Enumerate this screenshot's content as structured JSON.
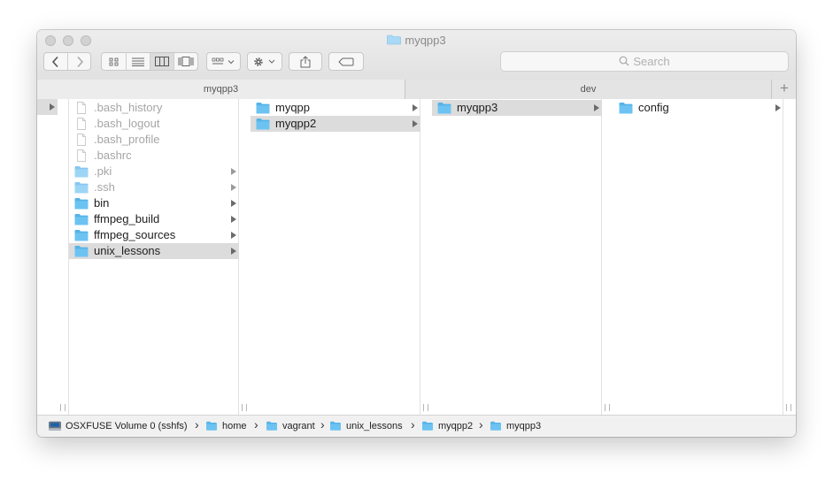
{
  "window": {
    "title": "myqpp3"
  },
  "toolbar": {
    "back_icon": "chevron-left-icon",
    "forward_icon": "chevron-right-icon",
    "view_modes": [
      "icon-view",
      "list-view",
      "column-view",
      "gallery-view"
    ],
    "active_view": "column-view",
    "search_placeholder": "Search"
  },
  "tabs": [
    {
      "label": "myqpp3",
      "active": true
    },
    {
      "label": "dev",
      "active": false
    }
  ],
  "columns": [
    {
      "items": []
    },
    {
      "items": [
        {
          "label": ".bash_history",
          "kind": "file",
          "dim": true,
          "arrow": false,
          "selected": false
        },
        {
          "label": ".bash_logout",
          "kind": "file",
          "dim": true,
          "arrow": false,
          "selected": false
        },
        {
          "label": ".bash_profile",
          "kind": "file",
          "dim": true,
          "arrow": false,
          "selected": false
        },
        {
          "label": ".bashrc",
          "kind": "file",
          "dim": true,
          "arrow": false,
          "selected": false
        },
        {
          "label": ".pki",
          "kind": "folder",
          "dim": true,
          "arrow": true,
          "selected": false
        },
        {
          "label": ".ssh",
          "kind": "folder",
          "dim": true,
          "arrow": true,
          "selected": false
        },
        {
          "label": "bin",
          "kind": "folder",
          "dim": false,
          "arrow": true,
          "selected": false
        },
        {
          "label": "ffmpeg_build",
          "kind": "folder",
          "dim": false,
          "arrow": true,
          "selected": false
        },
        {
          "label": "ffmpeg_sources",
          "kind": "folder",
          "dim": false,
          "arrow": true,
          "selected": false
        },
        {
          "label": "unix_lessons",
          "kind": "folder",
          "dim": false,
          "arrow": true,
          "selected": true
        }
      ]
    },
    {
      "items": [
        {
          "label": "myqpp",
          "kind": "folder",
          "dim": false,
          "arrow": true,
          "selected": false
        },
        {
          "label": "myqpp2",
          "kind": "folder",
          "dim": false,
          "arrow": true,
          "selected": true
        }
      ]
    },
    {
      "items": [
        {
          "label": "myqpp3",
          "kind": "folder",
          "dim": false,
          "arrow": true,
          "selected": true
        }
      ]
    },
    {
      "items": [
        {
          "label": "config",
          "kind": "folder",
          "dim": false,
          "arrow": true,
          "selected": false
        }
      ]
    }
  ],
  "pathbar": [
    {
      "label": "OSXFUSE Volume 0 (sshfs)",
      "icon": "drive-icon"
    },
    {
      "label": "home",
      "icon": "folder-icon"
    },
    {
      "label": "vagrant",
      "icon": "folder-icon"
    },
    {
      "label": "unix_lessons",
      "icon": "folder-icon"
    },
    {
      "label": "myqpp2",
      "icon": "folder-icon"
    },
    {
      "label": "myqpp3",
      "icon": "folder-icon"
    }
  ],
  "colors": {
    "folder": "#6cc3f2",
    "folder_tab": "#55b3e8",
    "selection": "#dcdcdc"
  }
}
